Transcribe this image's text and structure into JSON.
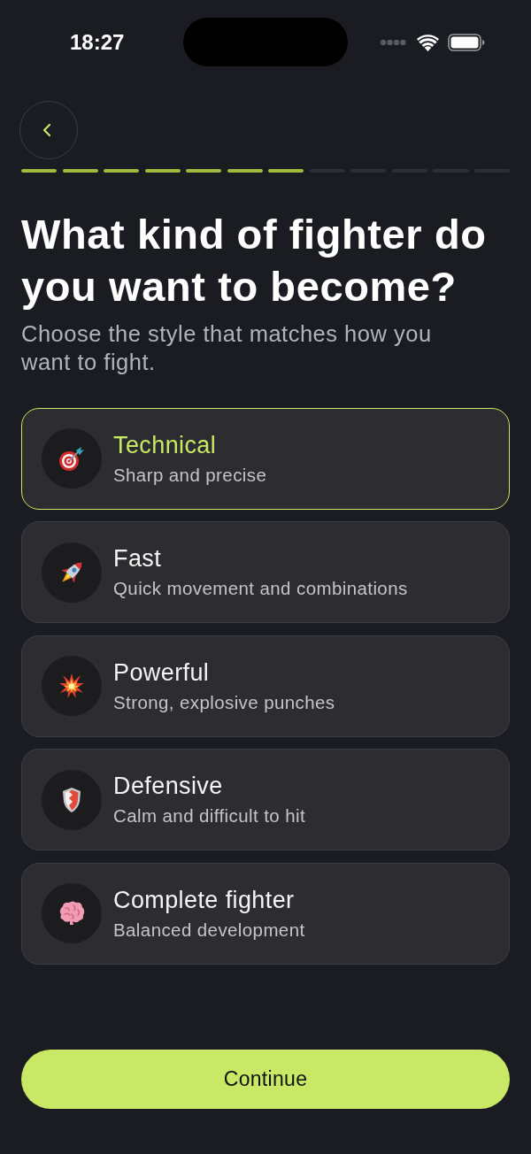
{
  "status_bar": {
    "time": "18:27"
  },
  "progress": {
    "steps": [
      {
        "completed": true
      },
      {
        "completed": true
      },
      {
        "completed": true
      },
      {
        "completed": true
      },
      {
        "completed": true
      },
      {
        "completed": true
      },
      {
        "completed": true
      },
      {
        "completed": false
      },
      {
        "completed": false
      },
      {
        "completed": false
      },
      {
        "completed": false
      },
      {
        "completed": false
      }
    ]
  },
  "title": "What kind of fighter do you want to become?",
  "subtitle": "Choose the style that matches how you want to fight.",
  "options": [
    {
      "title": "Technical",
      "description": "Sharp and precise",
      "selected": true
    },
    {
      "title": "Fast",
      "description": "Quick movement and combinations",
      "selected": false
    },
    {
      "title": "Powerful",
      "description": "Strong, explosive punches",
      "selected": false
    },
    {
      "title": "Defensive",
      "description": "Calm and difficult to hit",
      "selected": false
    },
    {
      "title": "Complete fighter",
      "description": "Balanced development",
      "selected": false
    }
  ],
  "continue_button": {
    "label": "Continue"
  }
}
